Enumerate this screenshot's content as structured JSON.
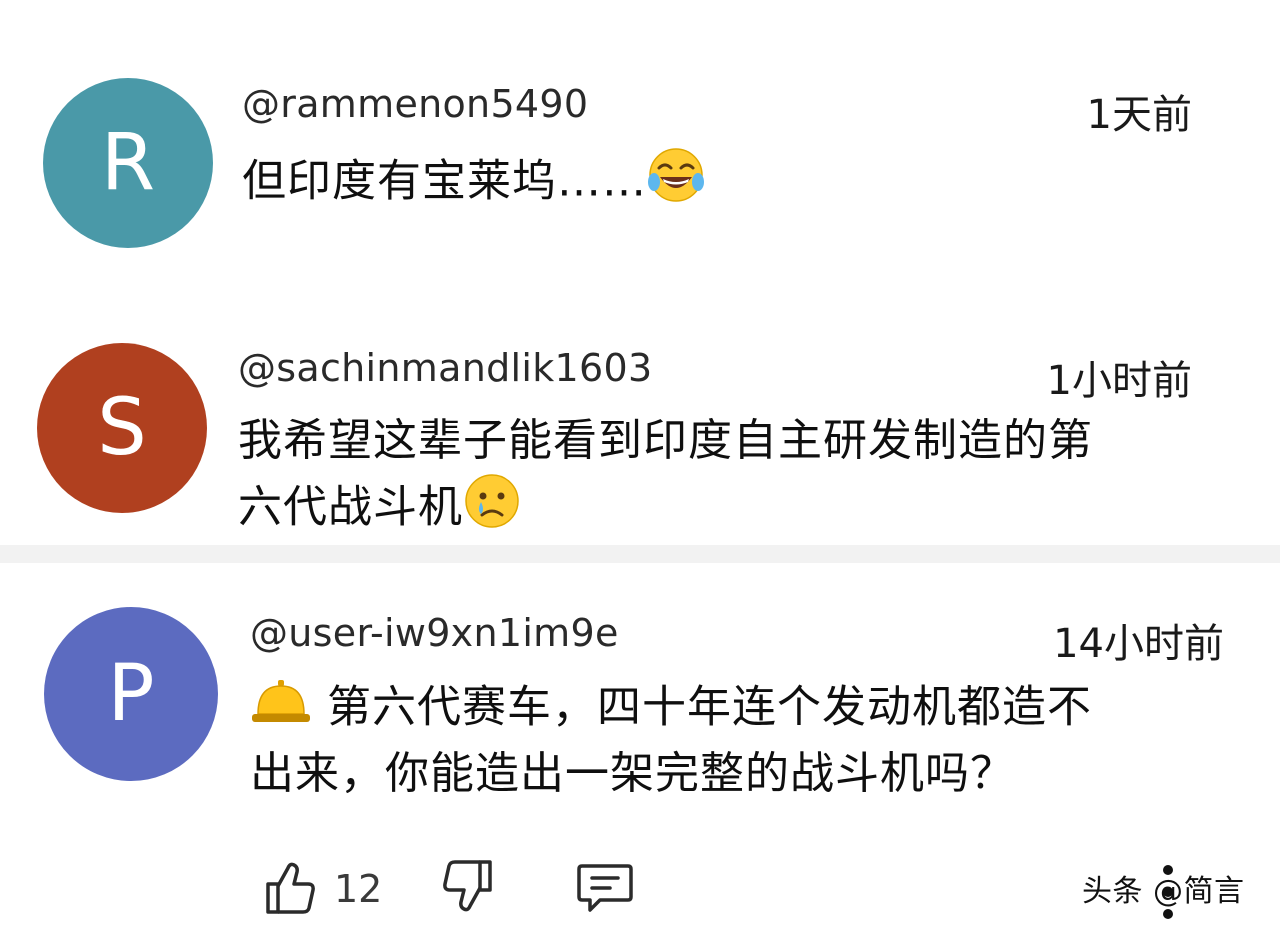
{
  "comments": [
    {
      "avatar_letter": "R",
      "avatar_color": "#4a99a8",
      "username": "@rammenon5490",
      "time": "1天前",
      "text": "但印度有宝莱坞……",
      "emoji": "face-with-tears-of-joy"
    },
    {
      "avatar_letter": "S",
      "avatar_color": "#b0401f",
      "username": "@sachinmandlik1603",
      "time": "1小时前",
      "text_line1": "我希望这辈子能看到印度自主研发制造的第",
      "text_line2": "六代战斗机",
      "emoji": "crying-face"
    },
    {
      "avatar_letter": "P",
      "avatar_color": "#5c6bc0",
      "username": "@user-iw9xn1im9e",
      "time": "14小时前",
      "text_line1": " 第六代赛车，四十年连个发动机都造不",
      "text_line2": "出来，你能造出一架完整的战斗机吗？",
      "emoji": "bellhop-bell"
    }
  ],
  "actions": {
    "like_count": "12",
    "like_icon": "thumbs-up-icon",
    "dislike_icon": "thumbs-down-icon",
    "reply_icon": "comment-icon"
  },
  "watermark": "头条 @简言",
  "colors": {
    "divider": "#f2f2f2",
    "icon_stroke": "#2b2b2b"
  }
}
